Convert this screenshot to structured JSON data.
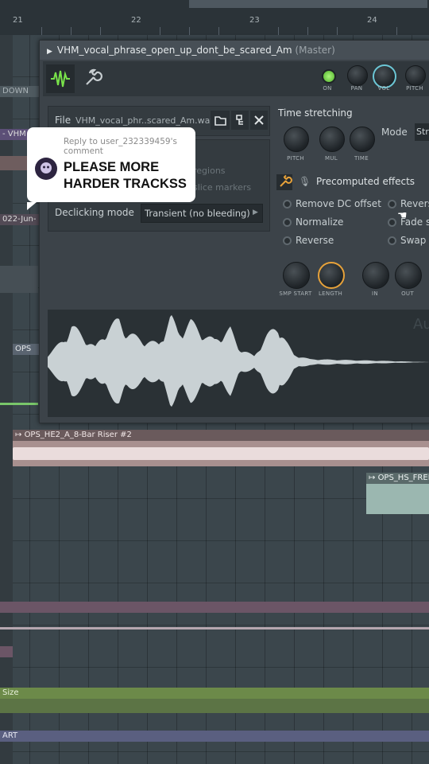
{
  "ruler": {
    "bars": [
      "21",
      "22",
      "23",
      "24"
    ]
  },
  "tracks": {
    "left_labels": [
      "DOWN",
      "- VHM",
      "022-Jun-",
      "OPS"
    ],
    "riser_clip": "OPS_HE2_A_8-Bar Riser #2",
    "hs_clip": "OPS_HS_FREE",
    "size_label": "Size",
    "art_label": "ART"
  },
  "window": {
    "title": "VHM_vocal_phrase_open_up_dont_be_scared_Am",
    "master": "(Master)",
    "toolbar_knobs": [
      "ON",
      "PAN",
      "VOL",
      "PITCH"
    ],
    "file_label": "File",
    "file_name": "VHM_vocal_phr..scared_Am.wav",
    "regions_text": "regions",
    "slice_text": "slice markers",
    "declick_label": "Declicking mode",
    "declick_value": "Transient (no bleeding)",
    "time_stretching": "Time stretching",
    "mode_label": "Mode",
    "mode_value": "Str",
    "stretch_knobs": [
      "PITCH",
      "MUL",
      "TIME"
    ],
    "precomputed": "Precomputed effects",
    "effects_left": [
      "Remove DC offset",
      "Normalize",
      "Reverse"
    ],
    "effects_right": [
      "Reverse",
      "Fade st",
      "Swap s"
    ],
    "bottom_knobs": [
      "SMP START",
      "LENGTH",
      "IN",
      "OUT"
    ],
    "wave_corner": "Au"
  },
  "comment": {
    "reply_to": "Reply to user_232339459's comment",
    "text": "PLEASE MORE HARDER TRACKSS"
  },
  "colors": {
    "accent": "#e7a23a",
    "green": "#79e24a",
    "teal": "#6cc7d6"
  }
}
